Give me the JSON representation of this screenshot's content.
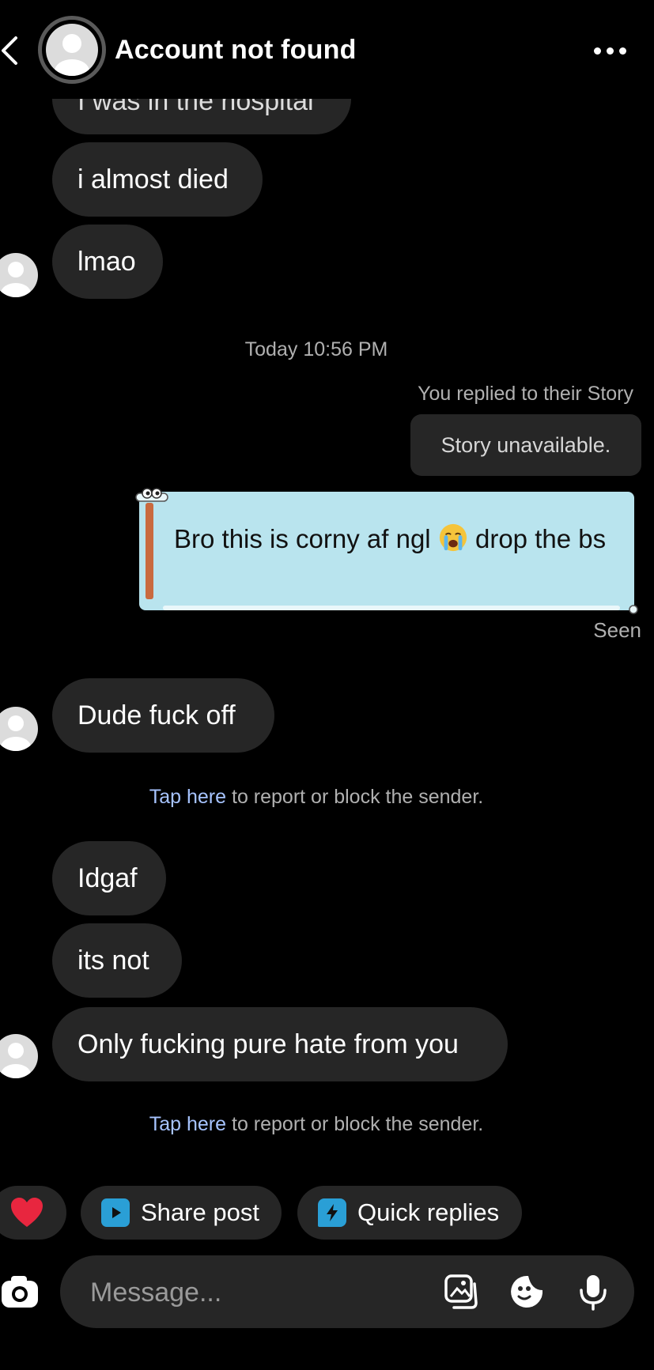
{
  "header": {
    "title": "Account not found"
  },
  "messages": {
    "clipped": "I was in the hospital",
    "m1": "i almost died",
    "m2": "lmao",
    "timestamp": "Today 10:56 PM",
    "replied_note": "You replied to their Story",
    "story_unavailable": "Story unavailable.",
    "sent_text": "Bro this is corny af ngl",
    "sent_text_after": "drop the bs",
    "seen": "Seen",
    "m3": "Dude fuck off",
    "report_link": "Tap here",
    "report_rest": " to report or block the sender.",
    "m4": "Idgaf",
    "m5": "its not",
    "m6": "Only fucking pure hate from you"
  },
  "quick_actions": {
    "share_post": "Share post",
    "quick_replies": "Quick replies"
  },
  "composer": {
    "placeholder": "Message..."
  },
  "colors": {
    "bubble": "#262626",
    "sent_note_bg": "#b9e4ee",
    "link": "#a7c4ff",
    "heart": "#e8263f",
    "share_icon": "#2a9fd6"
  }
}
